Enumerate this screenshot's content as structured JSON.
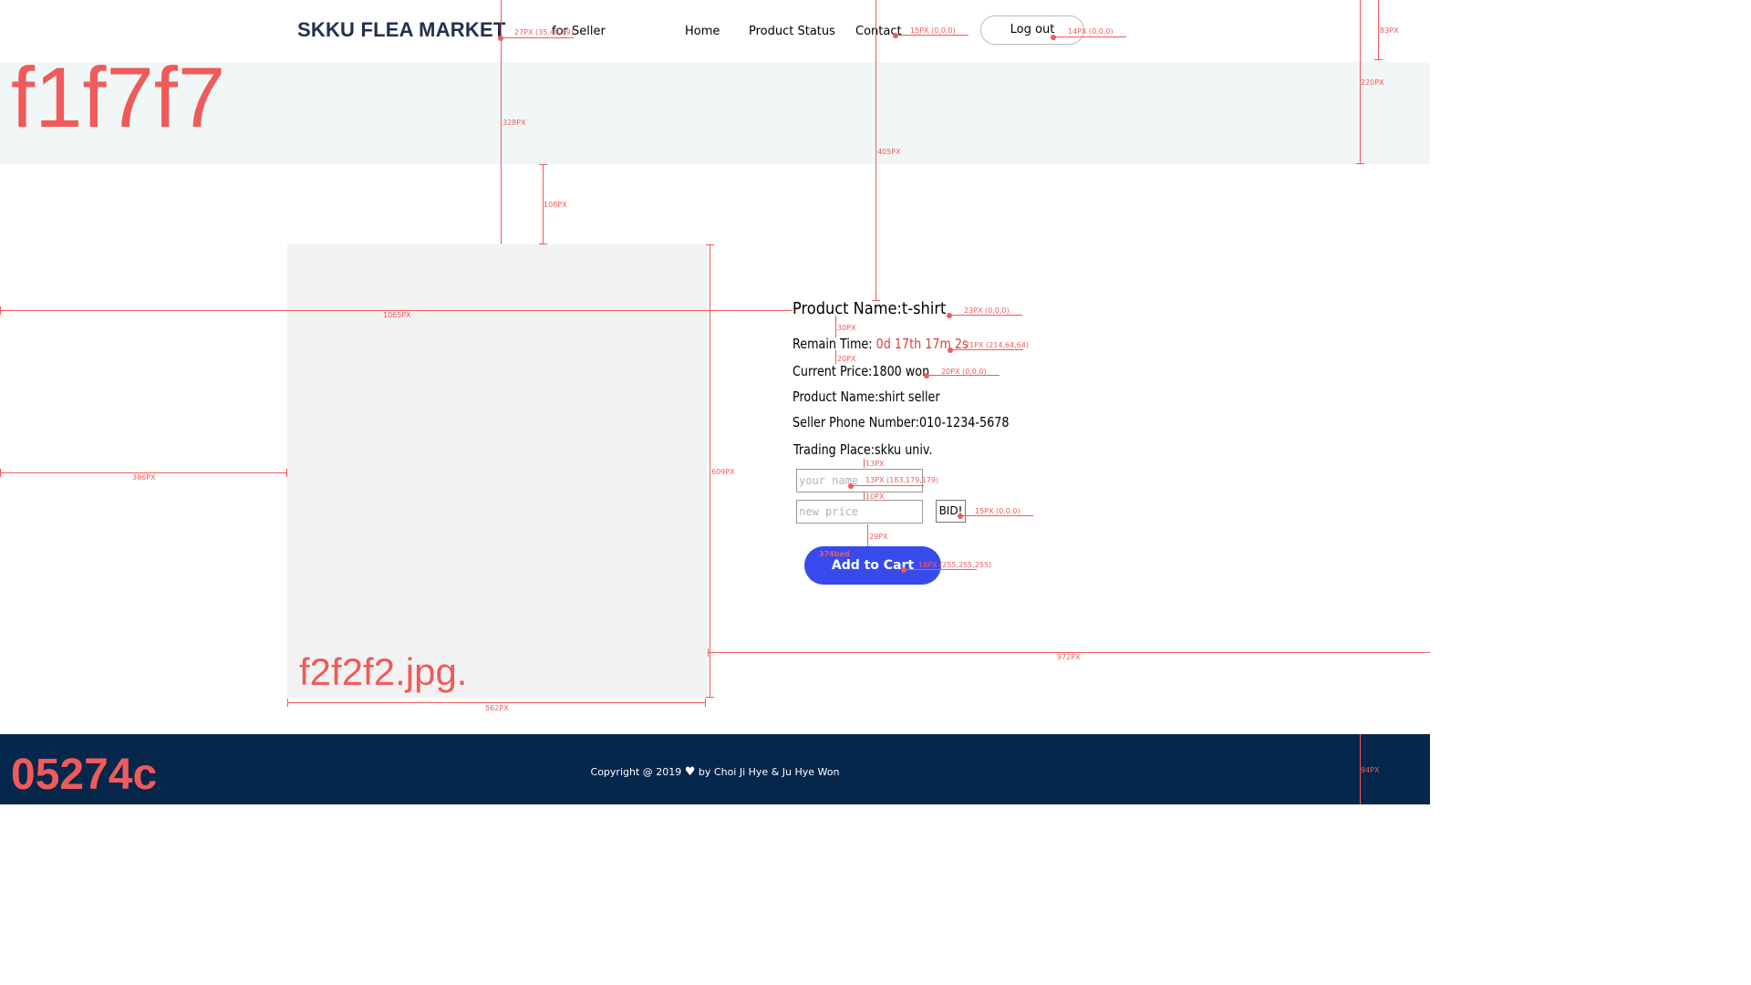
{
  "header": {
    "brand": "SKKU FLEA MARKET",
    "role_link": "for Seller",
    "nav": [
      "Home",
      "Product Status",
      "Contact"
    ],
    "logout_label": "Log out"
  },
  "hero": {
    "color_code": "f1f7f7"
  },
  "product_image": {
    "label": "f2f2f2.jpg."
  },
  "product": {
    "name_label": "Product Name:",
    "name_value": "t-shirt",
    "remain_label": "Remain Time:",
    "remain_value": "0d 17th 17m 2s",
    "price_label": "Current Price:",
    "price_value": "1800 won",
    "seller_label": "Product Name:",
    "seller_value": "shirt seller",
    "phone_label": "Seller Phone Number:",
    "phone_value": "010-1234-5678",
    "place_label": "Trading Place:",
    "place_value": "skku univ."
  },
  "form": {
    "name_placeholder": "your name",
    "price_placeholder": "new price",
    "bid_label": "BID!",
    "cart_label": "Add to Cart",
    "cart_color_note": "374bed"
  },
  "footer": {
    "color_code": "05274c",
    "copyright_prefix": "Copyright @ 2019",
    "copyright_suffix": "by Choi Ji Hye & Ju Hye Won"
  },
  "annotations": {
    "brand_spec": "27PX (35,48,89)",
    "nav_spec": "15PX (0,0,0)",
    "logout_spec": "14PX (0,0,0)",
    "header_h": "83PX",
    "hero_h": "220PX",
    "top_328": "328PX",
    "gap_108": "108PX",
    "top_405": "405PX",
    "left_1065": "1065PX",
    "left_386": "386PX",
    "img_h": "609PX",
    "right_972": "972PX",
    "img_w": "562PX",
    "name_spec": "23PX (0,0,0)",
    "gap_30": "30PX",
    "remain_spec": "21PX (214,64,64)",
    "gap_20": "20PX",
    "price_spec": "20PX (0,0,0)",
    "gap_13": "13PX",
    "input_spec": "13PX (183,179,179)",
    "gap_10": "10PX",
    "bid_spec": "15PX (0,0,0)",
    "gap_29": "29PX",
    "cart_spec": "18PX (255,255,255)",
    "footer_h": "94PX"
  },
  "colors": {
    "brand": "#23304f",
    "hero_bg": "#f1f7f7",
    "image_bg": "#f2f2f2",
    "remain_text": "#d64040",
    "cart_button": "#374bed",
    "footer_bg": "#05274c",
    "annotation": "#f05a5a"
  }
}
